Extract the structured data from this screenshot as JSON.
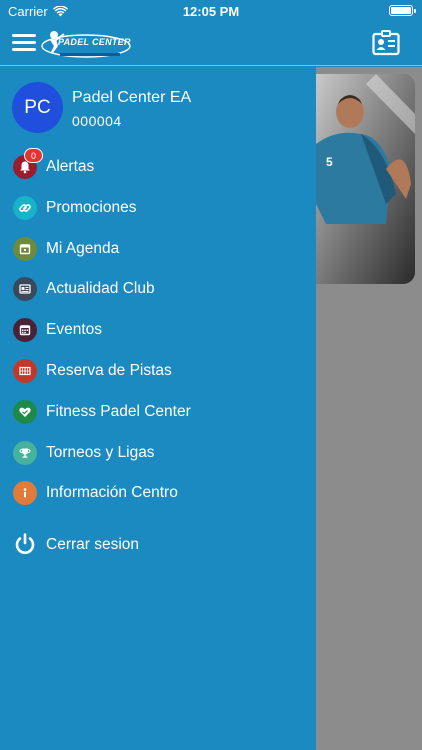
{
  "status_bar": {
    "carrier": "Carrier",
    "time": "12:05 PM",
    "battery_level": 1.0
  },
  "nav_bar": {
    "logo_text": "PADEL CENTER",
    "menu_icon": "hamburger-icon",
    "right_icon": "contact-card-icon"
  },
  "profile": {
    "initials": "PC",
    "name": "Padel Center EA",
    "id": "000004",
    "avatar_color": "#1f4fdc"
  },
  "menu": {
    "items": [
      {
        "label": "Alertas",
        "icon": "bell-icon",
        "color": "#9b1c2e",
        "badge": "0"
      },
      {
        "label": "Promociones",
        "icon": "link-icon",
        "color": "#17b3c9"
      },
      {
        "label": "Mi Agenda",
        "icon": "calendar-icon",
        "color": "#6e8a3c"
      },
      {
        "label": "Actualidad Club",
        "icon": "news-icon",
        "color": "#3a4a5c"
      },
      {
        "label": "Eventos",
        "icon": "event-icon",
        "color": "#4a2238"
      },
      {
        "label": "Reserva de Pistas",
        "icon": "court-icon",
        "color": "#c0392b"
      },
      {
        "label": "Fitness Padel Center",
        "icon": "heart-icon",
        "color": "#1e8a4a"
      },
      {
        "label": "Torneos y Ligas",
        "icon": "trophy-icon",
        "color": "#46b29d"
      },
      {
        "label": "Información Centro",
        "icon": "info-icon",
        "color": "#e07b3a"
      }
    ],
    "logout": {
      "label": "Cerrar sesion",
      "icon": "power-icon"
    }
  },
  "colors": {
    "primary": "#1a8ac0",
    "overlay": "#8c8c8c",
    "badge": "#e13434"
  }
}
